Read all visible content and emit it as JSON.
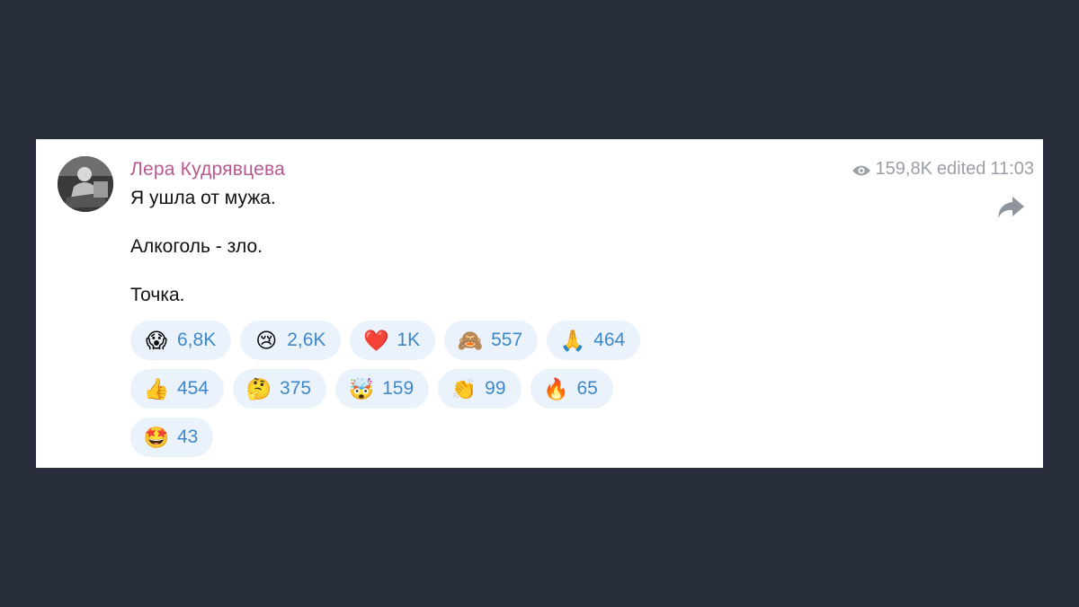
{
  "post": {
    "author": "Лера Кудрявцева",
    "views": "159,8K",
    "edited_label": "edited",
    "time": "11:03",
    "lines": [
      "Я ушла от мужа.",
      "Алкоголь - зло.",
      "Точка."
    ]
  },
  "icons": {
    "views": "eye-icon",
    "share": "share-arrow-icon"
  },
  "colors": {
    "background": "#272d3b",
    "author": "#b9588f",
    "meta": "#9aa0a6",
    "reaction_bg": "#eaf2fb",
    "reaction_count": "#3e88c9"
  },
  "reactions": [
    {
      "emoji": "😱",
      "name": "face-screaming",
      "count": "6,8K"
    },
    {
      "emoji": "😢",
      "name": "crying-face",
      "count": "2,6K"
    },
    {
      "emoji": "❤️",
      "name": "red-heart",
      "count": "1K"
    },
    {
      "emoji": "🙈",
      "name": "see-no-evil-monkey",
      "count": "557"
    },
    {
      "emoji": "🙏",
      "name": "folded-hands",
      "count": "464"
    },
    {
      "emoji": "👍",
      "name": "thumbs-up",
      "count": "454"
    },
    {
      "emoji": "🤔",
      "name": "thinking-face",
      "count": "375"
    },
    {
      "emoji": "🤯",
      "name": "exploding-head",
      "count": "159"
    },
    {
      "emoji": "👏",
      "name": "clapping-hands",
      "count": "99"
    },
    {
      "emoji": "🔥",
      "name": "fire",
      "count": "65"
    },
    {
      "emoji": "🤩",
      "name": "star-struck",
      "count": "43"
    }
  ]
}
